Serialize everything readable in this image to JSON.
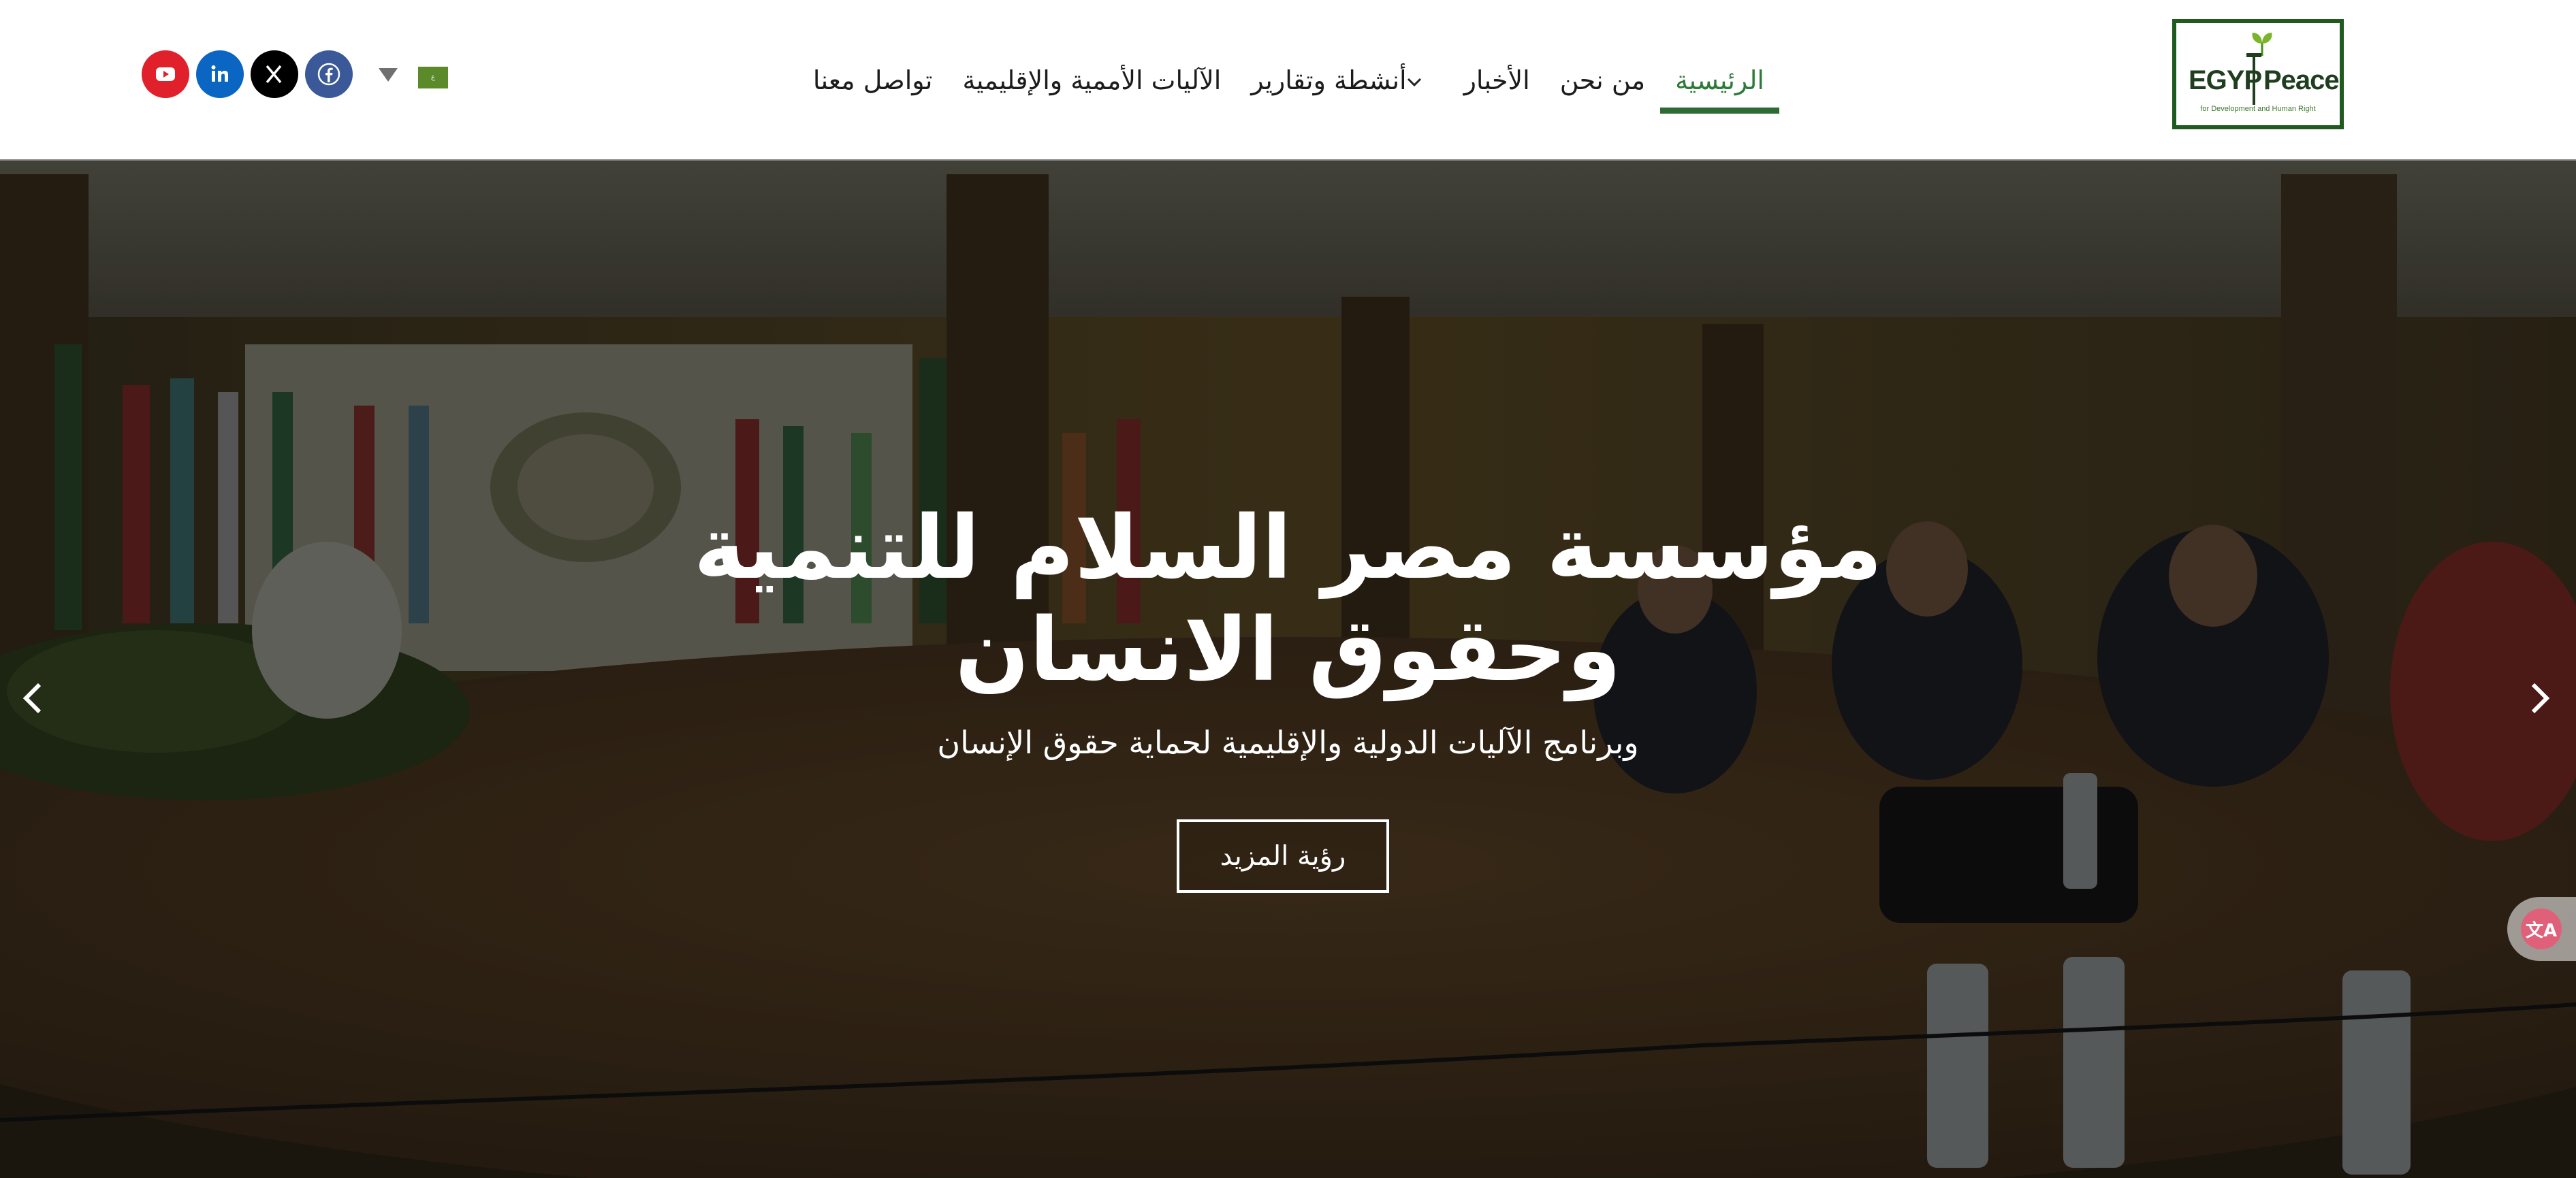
{
  "header": {
    "logo_text_left": "EGYP",
    "logo_text_right": "Peace",
    "logo_tagline": "for Development and Human Right",
    "nav": [
      {
        "label": "الرئيسية",
        "active": true
      },
      {
        "label": "من نحن",
        "active": false
      },
      {
        "label": "الأخبار",
        "active": false
      },
      {
        "label": "أنشطة وتقارير",
        "active": false,
        "has_dropdown": true
      },
      {
        "label": "الآليات الأممية والإقليمية",
        "active": false
      },
      {
        "label": "تواصل معنا",
        "active": false
      }
    ],
    "language_flag_text": "ع",
    "social": [
      {
        "name": "youtube",
        "color": "#e0202a"
      },
      {
        "name": "linkedin",
        "color": "#0a66c2"
      },
      {
        "name": "x",
        "color": "#000000"
      },
      {
        "name": "facebook",
        "color": "#3b5998"
      }
    ]
  },
  "hero": {
    "title_line1": "مؤسسة مصر السلام للتنمية",
    "title_line2": "وحقوق الانسان",
    "subtitle": "وبرنامج الآليات الدولية والإقليمية لحماية حقوق الإنسان",
    "button_label": "رؤية المزيد",
    "prev_icon": "chevron-left-icon",
    "next_icon": "chevron-right-icon"
  },
  "translate_widget": {
    "icon_text": "文A"
  },
  "colors": {
    "accent_green": "#2e7a3a",
    "logo_green": "#1f5a1f"
  }
}
